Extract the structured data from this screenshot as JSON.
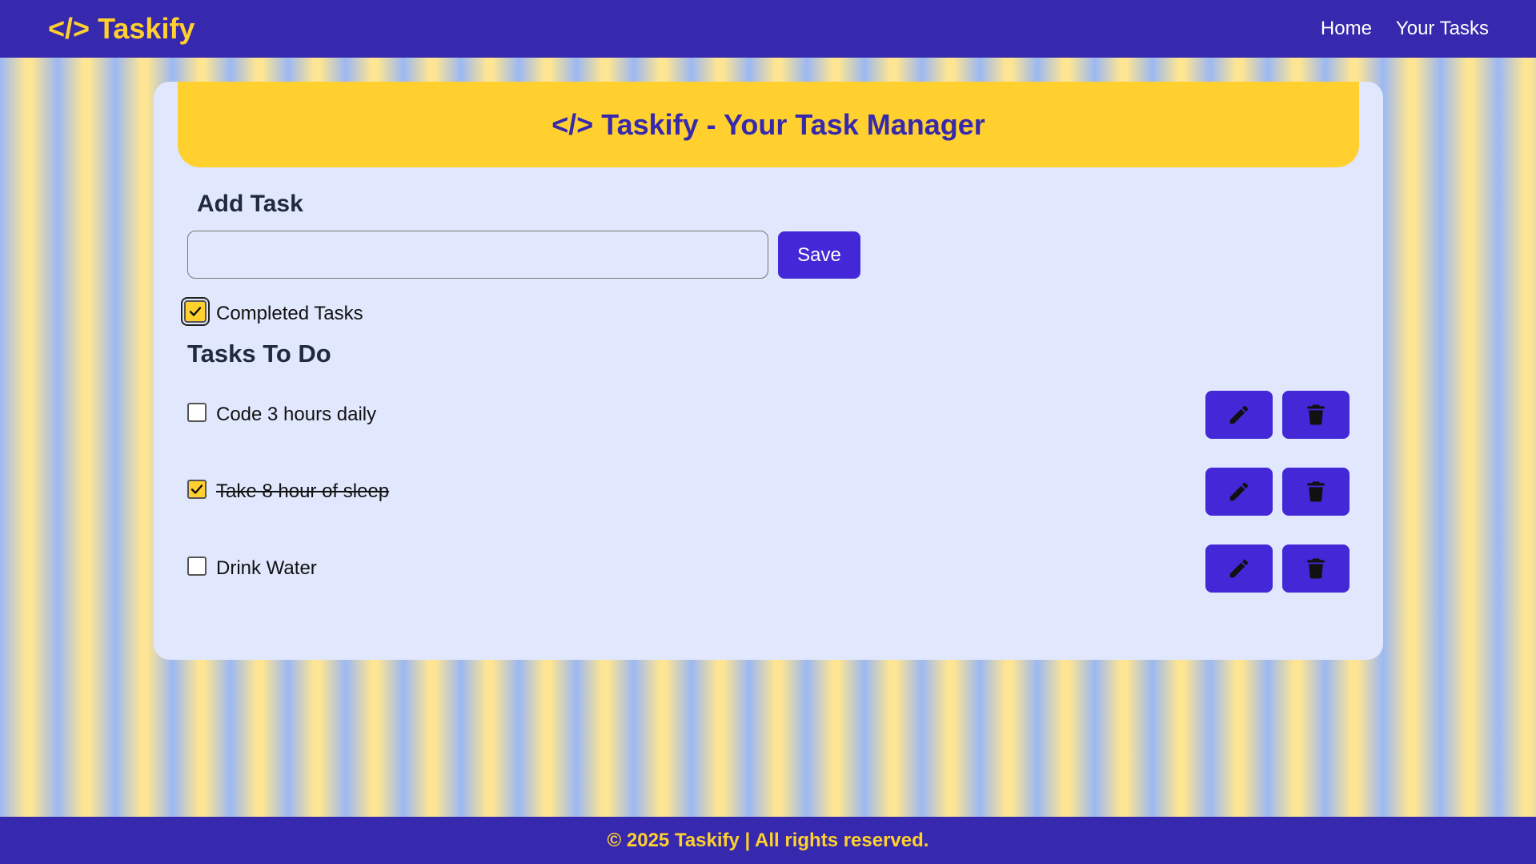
{
  "navbar": {
    "brand_icon": "</>",
    "brand_name": "Taskify",
    "links": [
      {
        "label": "Home"
      },
      {
        "label": "Your Tasks"
      }
    ]
  },
  "banner": {
    "icon": "</>",
    "title": "Taskify - Your Task Manager"
  },
  "add_task": {
    "heading": "Add Task",
    "input_value": "",
    "save_label": "Save"
  },
  "filter": {
    "label": "Completed Tasks",
    "checked": true
  },
  "tasks_heading": "Tasks To Do",
  "tasks": [
    {
      "text": "Code 3 hours daily",
      "completed": false
    },
    {
      "text": "Take 8 hour of sleep",
      "completed": true
    },
    {
      "text": "Drink Water",
      "completed": false
    }
  ],
  "icons": {
    "edit": "pencil-icon",
    "delete": "trash-icon"
  },
  "footer": {
    "text": "© 2025 Taskify | All rights reserved."
  },
  "colors": {
    "primary": "#3729ad",
    "button": "#4427d6",
    "accent": "#ffd02e",
    "card": "#e1e7fd"
  }
}
